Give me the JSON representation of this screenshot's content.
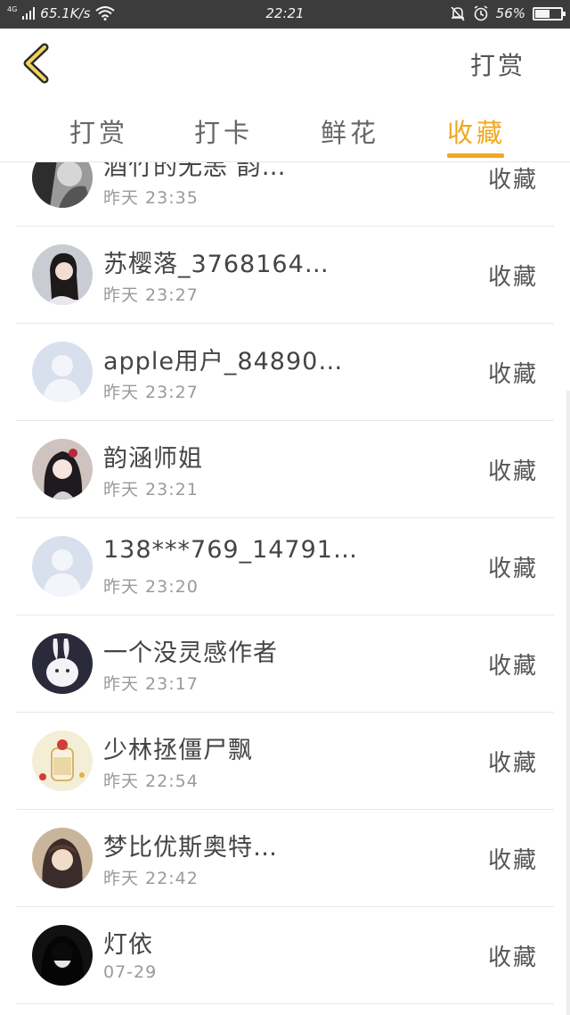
{
  "status_bar": {
    "network": "4G",
    "speed": "65.1K/s",
    "time": "22:21",
    "battery": "56%",
    "battery_level": 0.56,
    "icons": [
      "signal-icon",
      "wifi-icon",
      "bell-muted-icon",
      "alarm-icon",
      "battery-icon"
    ]
  },
  "header": {
    "back_icon": "chevron-left-icon",
    "right_label": "打赏"
  },
  "tabs": [
    {
      "label": "打赏",
      "active": false
    },
    {
      "label": "打卡",
      "active": false
    },
    {
      "label": "鲜花",
      "active": false
    },
    {
      "label": "收藏",
      "active": true
    }
  ],
  "colors": {
    "accent": "#f0a820",
    "status_bar": "#3c3c3c"
  },
  "list": [
    {
      "name": "酒竹的无恙 韵…",
      "time": "昨天 23:35",
      "action": "收藏",
      "avatar": "photo-bw"
    },
    {
      "name": "苏樱落_3768164…",
      "time": "昨天 23:27",
      "action": "收藏",
      "avatar": "photo-girl"
    },
    {
      "name": "apple用户_84890…",
      "time": "昨天 23:27",
      "action": "收藏",
      "avatar": "default"
    },
    {
      "name": "韵涵师姐",
      "time": "昨天 23:21",
      "action": "收藏",
      "avatar": "photo-anime"
    },
    {
      "name": "138***769_14791…",
      "time": "昨天 23:20",
      "action": "收藏",
      "avatar": "default"
    },
    {
      "name": "一个没灵感作者",
      "time": "昨天 23:17",
      "action": "收藏",
      "avatar": "photo-rabbit"
    },
    {
      "name": "少林拯僵尸飘",
      "time": "昨天 22:54",
      "action": "收藏",
      "avatar": "photo-drink"
    },
    {
      "name": "梦比优斯奥特…",
      "time": "昨天 22:42",
      "action": "收藏",
      "avatar": "photo-anime2"
    },
    {
      "name": "灯依",
      "time": "07-29",
      "action": "收藏",
      "avatar": "photo-dark"
    }
  ]
}
